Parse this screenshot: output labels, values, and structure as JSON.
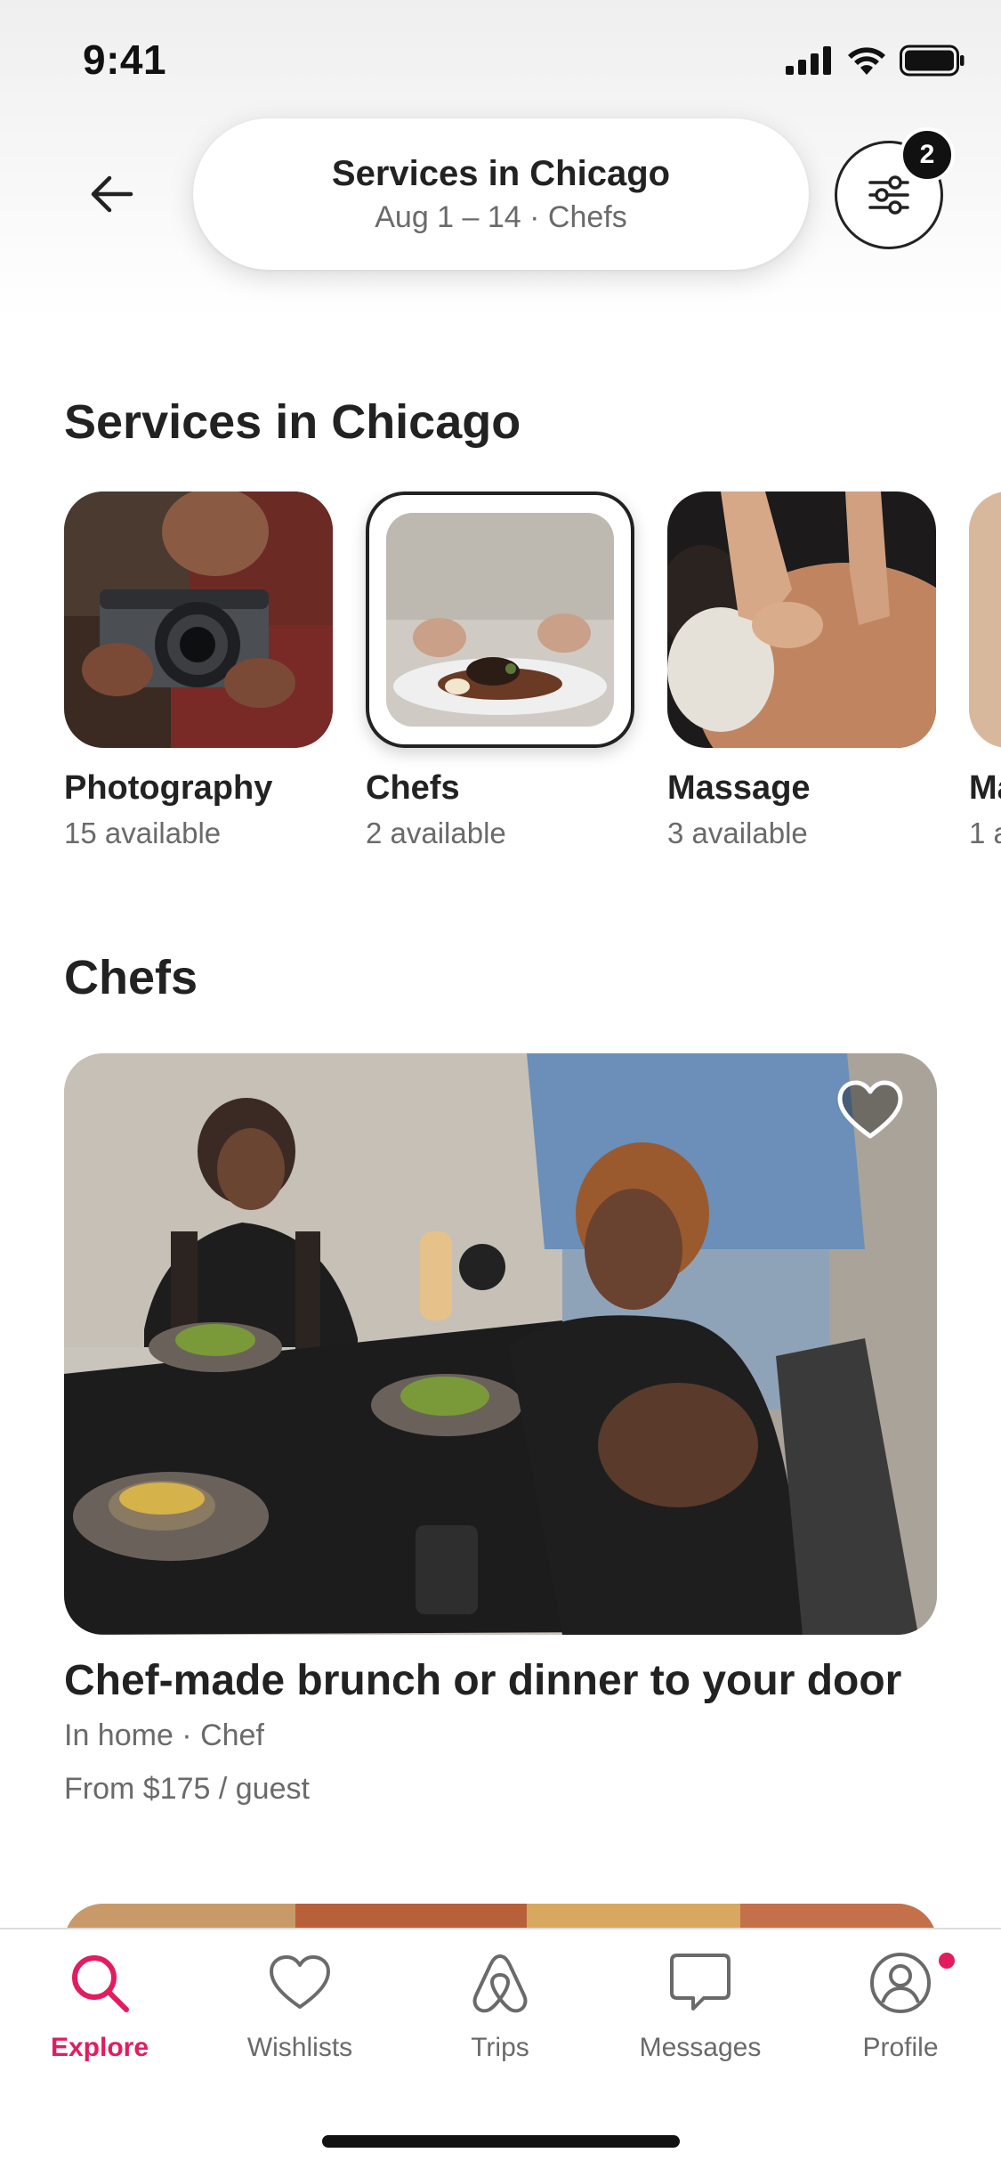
{
  "status_bar": {
    "time": "9:41"
  },
  "header": {
    "search_title": "Services in Chicago",
    "search_subtitle": "Aug 1 – 14 · Chefs",
    "filter_count": "2"
  },
  "categories_section": {
    "title": "Services in Chicago",
    "items": [
      {
        "label": "Photography",
        "count": "15 available"
      },
      {
        "label": "Chefs",
        "count": "2 available",
        "selected": true
      },
      {
        "label": "Massage",
        "count": "3 available"
      },
      {
        "label": "Ma",
        "count": "1 a"
      }
    ]
  },
  "listings_section": {
    "title": "Chefs",
    "listing": {
      "title": "Chef-made brunch or dinner to your door",
      "meta": "In home · Chef",
      "price": "From $175 / guest"
    }
  },
  "tab_bar": {
    "tabs": [
      {
        "label": "Explore",
        "icon": "search-icon",
        "active": true
      },
      {
        "label": "Wishlists",
        "icon": "heart-icon"
      },
      {
        "label": "Trips",
        "icon": "airbnb-logo-icon"
      },
      {
        "label": "Messages",
        "icon": "message-icon"
      },
      {
        "label": "Profile",
        "icon": "profile-icon"
      }
    ]
  },
  "colors": {
    "accent": "#e31c5f",
    "text": "#222222",
    "secondary_text": "#6a6a6a"
  }
}
